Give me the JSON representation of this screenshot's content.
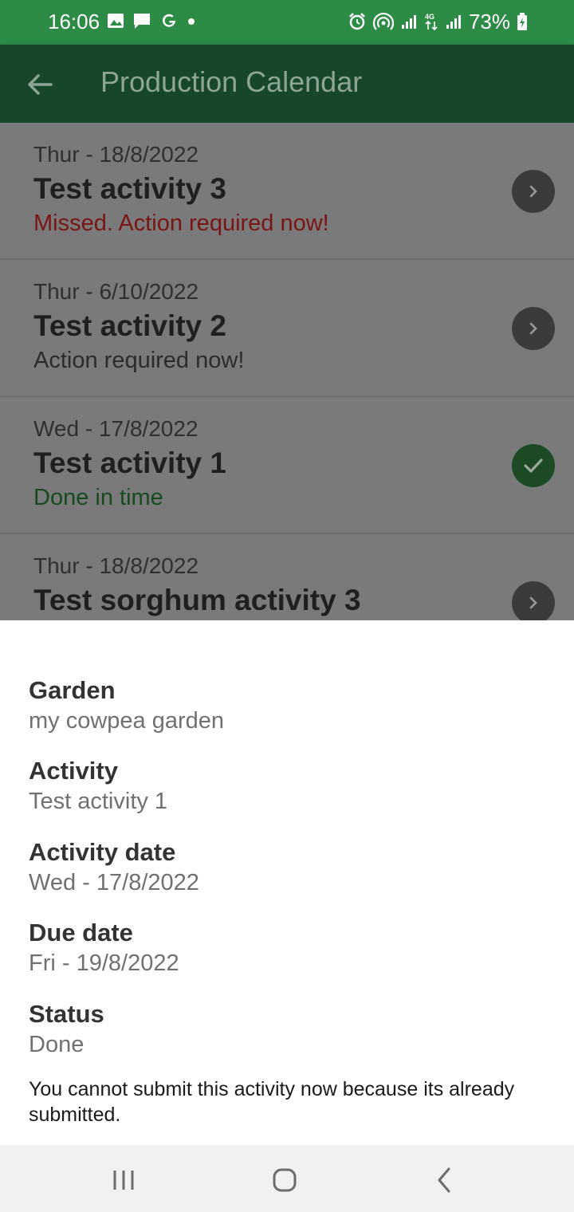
{
  "status_bar": {
    "time": "16:06",
    "battery": "73%",
    "left_icons": [
      "gallery-icon",
      "message-icon",
      "google-icon",
      "dot-icon"
    ],
    "right_icons": [
      "alarm-icon",
      "hotspot-icon",
      "signal-icon",
      "4g-icon",
      "signal-icon-2",
      "battery-icon"
    ]
  },
  "app_bar": {
    "title": "Production Calendar",
    "back_icon": "arrow-left-icon"
  },
  "activities": [
    {
      "date": "Thur - 18/8/2022",
      "name": "Test activity 3",
      "status": "Missed. Action required now!",
      "status_type": "missed",
      "icon": "chevron-right-icon"
    },
    {
      "date": "Thur - 6/10/2022",
      "name": "Test activity 2",
      "status": "Action required now!",
      "status_type": "action",
      "icon": "chevron-right-icon"
    },
    {
      "date": "Wed - 17/8/2022",
      "name": "Test activity 1",
      "status": "Done in time",
      "status_type": "done",
      "icon": "check-icon"
    },
    {
      "date": "Thur - 18/8/2022",
      "name": "Test sorghum activity 3",
      "status": "",
      "status_type": "",
      "icon": "chevron-right-icon"
    }
  ],
  "detail": {
    "garden_label": "Garden",
    "garden_value": "my cowpea garden",
    "activity_label": "Activity",
    "activity_value": "Test activity 1",
    "activity_date_label": "Activity date",
    "activity_date_value": "Wed - 17/8/2022",
    "due_date_label": "Due date",
    "due_date_value": "Fri - 19/8/2022",
    "status_label": "Status",
    "status_value": "Done",
    "note": "You cannot submit this activity now because its already submitted."
  },
  "nav_bar": {
    "icons": [
      "recent-apps-icon",
      "home-icon",
      "back-icon"
    ]
  },
  "colors": {
    "status_bar": "#2c8c46",
    "app_bar": "#17472a",
    "missed": "#7a1515",
    "done": "#174b1f"
  }
}
